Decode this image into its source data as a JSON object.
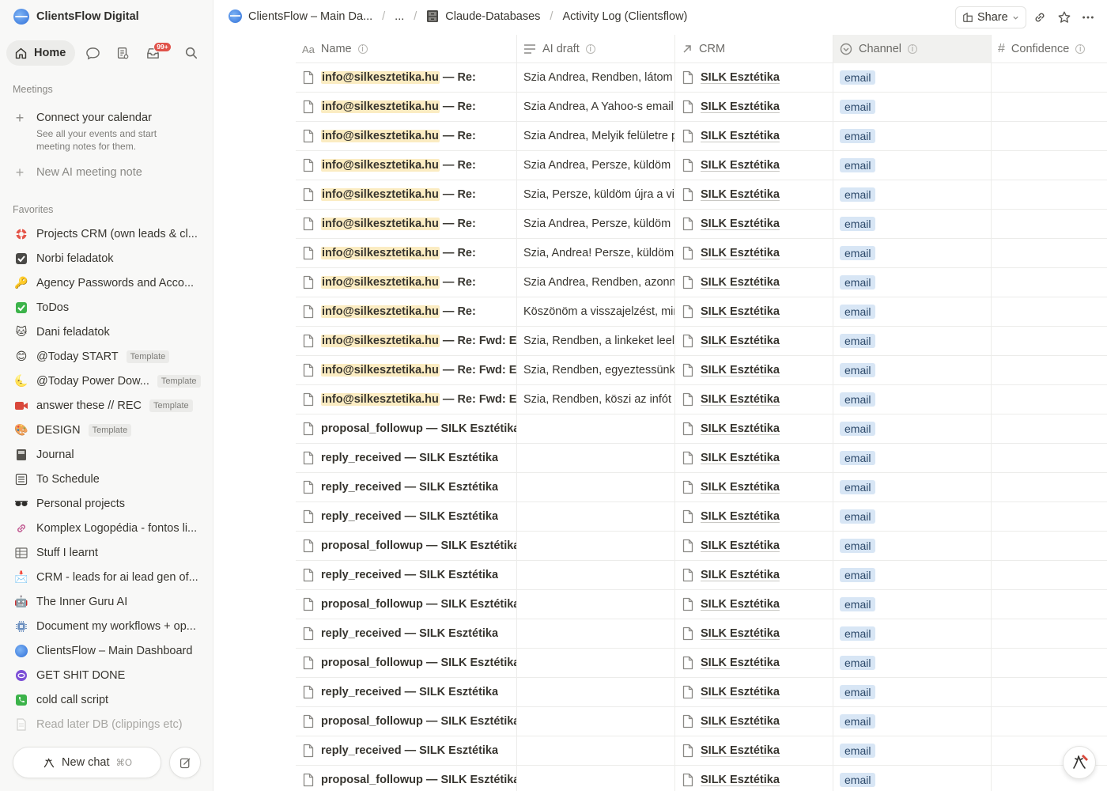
{
  "workspace": {
    "name": "ClientsFlow Digital"
  },
  "nav": {
    "home_label": "Home",
    "inbox_badge": "99+"
  },
  "meetings": {
    "section_title": "Meetings",
    "connect_title": "Connect your calendar",
    "connect_desc": "See all your events and start meeting notes for them.",
    "new_ai_note": "New AI meeting note"
  },
  "favorites": {
    "section_title": "Favorites",
    "items": [
      {
        "label": "Projects CRM (own leads & cl...",
        "icon": "lifebuoy-icon"
      },
      {
        "label": "Norbi feladatok",
        "icon": "checkbox-icon"
      },
      {
        "label": "Agency Passwords and Acco...",
        "icon": "key-icon"
      },
      {
        "label": "ToDos",
        "icon": "green-check-icon"
      },
      {
        "label": "Dani feladatok",
        "icon": "cat-icon"
      },
      {
        "label": "@Today START",
        "icon": "smile-icon",
        "template": "Template"
      },
      {
        "label": "@Today Power Dow...",
        "icon": "moon-icon",
        "template": "Template"
      },
      {
        "label": "answer these // REC",
        "icon": "video-camera-icon",
        "template": "Template"
      },
      {
        "label": "DESIGN",
        "icon": "palette-icon",
        "template": "Template"
      },
      {
        "label": "Journal",
        "icon": "notebook-icon"
      },
      {
        "label": "To Schedule",
        "icon": "calendar-list-icon"
      },
      {
        "label": "Personal projects",
        "icon": "sunglasses-icon"
      },
      {
        "label": "Komplex Logopédia - fontos li...",
        "icon": "link-icon"
      },
      {
        "label": "Stuff I learnt",
        "icon": "table-icon"
      },
      {
        "label": "CRM - leads for ai lead gen of...",
        "icon": "inbox-tray-icon"
      },
      {
        "label": "The Inner Guru AI",
        "icon": "robot-icon"
      },
      {
        "label": "Document my workflows + op...",
        "icon": "chip-icon"
      },
      {
        "label": "ClientsFlow – Main Dashboard",
        "icon": "clientsflow-logo-icon"
      },
      {
        "label": "GET SHIT DONE",
        "icon": "purple-badge-icon"
      },
      {
        "label": "cold call script",
        "icon": "phone-icon"
      },
      {
        "label": "Read later DB (clippings etc)",
        "icon": "document-icon"
      }
    ]
  },
  "bottom": {
    "new_chat": "New chat",
    "shortcut": "⌘O"
  },
  "breadcrumb": {
    "root": "ClientsFlow – Main Da...",
    "ellipsis": "...",
    "parent": "Claude-Databases",
    "current": "Activity Log (Clientsflow)"
  },
  "toolbar": {
    "share": "Share"
  },
  "table": {
    "columns": {
      "name": "Name",
      "ai_draft": "AI draft",
      "crm": "CRM",
      "channel": "Channel",
      "confidence": "Confidence"
    },
    "rows": [
      {
        "email": "info@silkesztetika.hu",
        "rest": " — Re:",
        "draft": "Szia Andrea, Rendben, látom a",
        "crm": "SILK Esztétika",
        "channel": "email"
      },
      {
        "email": "info@silkesztetika.hu",
        "rest": " — Re:",
        "draft": "Szia Andrea, A Yahoo-s email",
        "crm": "SILK Esztétika",
        "channel": "email"
      },
      {
        "email": "info@silkesztetika.hu",
        "rest": " — Re:",
        "draft": "Szia Andrea, Melyik felületre p",
        "crm": "SILK Esztétika",
        "channel": "email"
      },
      {
        "email": "info@silkesztetika.hu",
        "rest": " — Re:",
        "draft": "Szia Andrea, Persze, küldöm ú",
        "crm": "SILK Esztétika",
        "channel": "email"
      },
      {
        "email": "info@silkesztetika.hu",
        "rest": " — Re:",
        "draft": "Szia, Persze, küldöm újra a vid",
        "crm": "SILK Esztétika",
        "channel": "email"
      },
      {
        "email": "info@silkesztetika.hu",
        "rest": " — Re:",
        "draft": "Szia Andrea, Persze, küldöm ú",
        "crm": "SILK Esztétika",
        "channel": "email"
      },
      {
        "email": "info@silkesztetika.hu",
        "rest": " — Re:",
        "draft": "Szia, Andrea! Persze, küldöm",
        "crm": "SILK Esztétika",
        "channel": "email"
      },
      {
        "email": "info@silkesztetika.hu",
        "rest": " — Re:",
        "draft": "Szia Andrea, Rendben, azonna",
        "crm": "SILK Esztétika",
        "channel": "email"
      },
      {
        "email": "info@silkesztetika.hu",
        "rest": " — Re:",
        "draft": "Köszönöm a visszajelzést, mir",
        "crm": "SILK Esztétika",
        "channel": "email"
      },
      {
        "email": "info@silkesztetika.hu",
        "rest": " — Re: Fwd: Elké",
        "draft": "Szia, Rendben, a linkeket leell",
        "crm": "SILK Esztétika",
        "channel": "email"
      },
      {
        "email": "info@silkesztetika.hu",
        "rest": " — Re: Fwd: Elké",
        "draft": "Szia, Rendben, egyeztessünk",
        "crm": "SILK Esztétika",
        "channel": "email"
      },
      {
        "email": "info@silkesztetika.hu",
        "rest": " — Re: Fwd: Elké",
        "draft": "Szia, Rendben, köszi az infót a",
        "crm": "SILK Esztétika",
        "channel": "email"
      },
      {
        "email": "",
        "rest": "proposal_followup — SILK Esztétika",
        "draft": "",
        "crm": "SILK Esztétika",
        "channel": "email"
      },
      {
        "email": "",
        "rest": "reply_received — SILK Esztétika",
        "draft": "",
        "crm": "SILK Esztétika",
        "channel": "email"
      },
      {
        "email": "",
        "rest": "reply_received — SILK Esztétika",
        "draft": "",
        "crm": "SILK Esztétika",
        "channel": "email"
      },
      {
        "email": "",
        "rest": "reply_received — SILK Esztétika",
        "draft": "",
        "crm": "SILK Esztétika",
        "channel": "email"
      },
      {
        "email": "",
        "rest": "proposal_followup — SILK Esztétika",
        "draft": "",
        "crm": "SILK Esztétika",
        "channel": "email"
      },
      {
        "email": "",
        "rest": "reply_received — SILK Esztétika",
        "draft": "",
        "crm": "SILK Esztétika",
        "channel": "email"
      },
      {
        "email": "",
        "rest": "proposal_followup — SILK Esztétika",
        "draft": "",
        "crm": "SILK Esztétika",
        "channel": "email"
      },
      {
        "email": "",
        "rest": "reply_received — SILK Esztétika",
        "draft": "",
        "crm": "SILK Esztétika",
        "channel": "email"
      },
      {
        "email": "",
        "rest": "proposal_followup — SILK Esztétika",
        "draft": "",
        "crm": "SILK Esztétika",
        "channel": "email"
      },
      {
        "email": "",
        "rest": "reply_received — SILK Esztétika",
        "draft": "",
        "crm": "SILK Esztétika",
        "channel": "email"
      },
      {
        "email": "",
        "rest": "proposal_followup — SILK Esztétika",
        "draft": "",
        "crm": "SILK Esztétika",
        "channel": "email"
      },
      {
        "email": "",
        "rest": "reply_received — SILK Esztétika",
        "draft": "",
        "crm": "SILK Esztétika",
        "channel": "email"
      },
      {
        "email": "",
        "rest": "proposal_followup — SILK Esztétika",
        "draft": "",
        "crm": "SILK Esztétika",
        "channel": "email"
      }
    ]
  },
  "colors": {
    "highlight": "#fbecc2",
    "chip_bg": "#d8e6f5",
    "badge": "#e0524a"
  }
}
